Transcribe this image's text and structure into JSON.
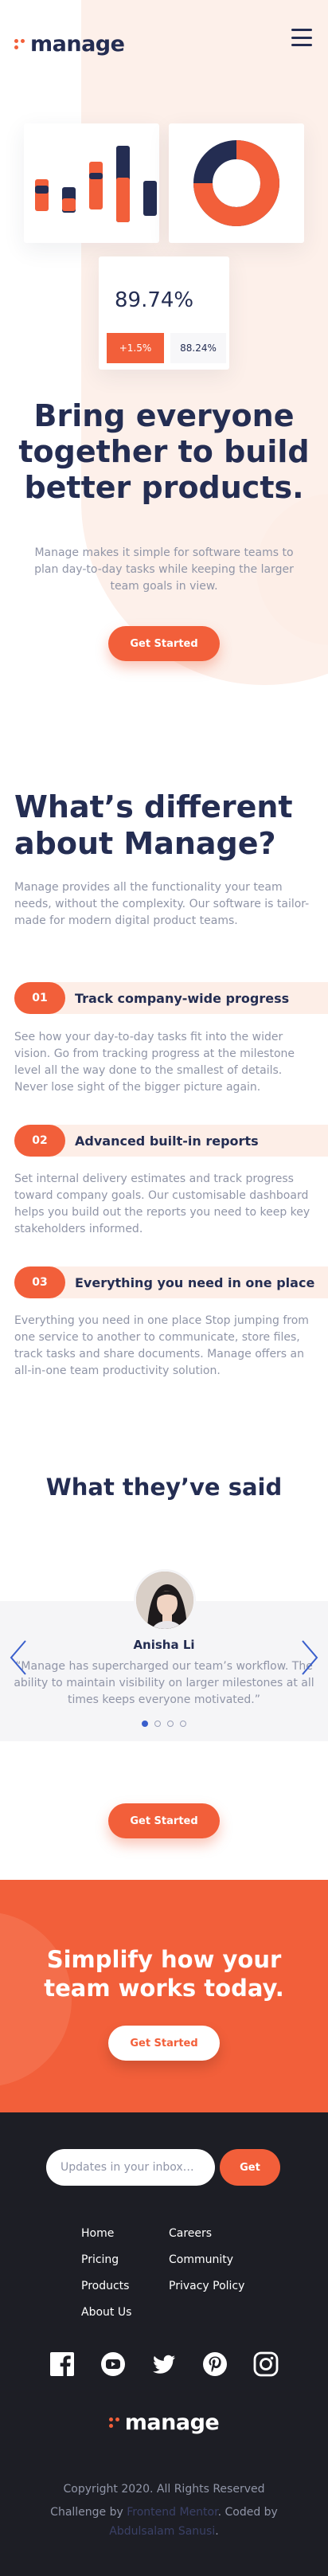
{
  "brand": {
    "name": "manage",
    "accent": "#f25f3a",
    "navy": "#242d52",
    "muted": "#9095a7",
    "pale": "#fdeee7"
  },
  "header": {
    "menu_icon": "hamburger-icon"
  },
  "hero": {
    "stat_value": "89.74%",
    "stat_badge": "+1.5%",
    "stat_secondary": "88.24%",
    "donut_fill": 0.75,
    "title": "Bring everyone together to build better products.",
    "text": "Manage makes it simple for software teams to plan day-to-day tasks while keeping the larger team goals in view.",
    "cta": "Get Started"
  },
  "different": {
    "title": "What’s different about Manage?",
    "text": "Manage provides all the functionality your team needs, without the complexity. Our software is tailor-made for modern digital product teams.",
    "features": [
      {
        "num": "01",
        "title": "Track company-wide progress",
        "desc": "See how your day-to-day tasks fit into the wider vision. Go from tracking progress at the milestone level all the way done to the smallest of details. Never lose sight of the bigger picture again."
      },
      {
        "num": "02",
        "title": "Advanced built-in reports",
        "desc": "Set internal delivery estimates and track progress toward company goals. Our customisable dashboard helps you build out the reports you need to keep key stakeholders informed."
      },
      {
        "num": "03",
        "title": "Everything you need in one place",
        "desc": "Everything you need in one place Stop jumping from one service to another to communicate, store files, track tasks and share documents. Manage offers an all-in-one team productivity solution."
      }
    ]
  },
  "testimonials": {
    "title": "What they’ve said",
    "name": "Anisha Li",
    "quote": "“Manage has supercharged our team’s workflow. The ability to maintain visibility on larger milestones at all times keeps everyone motivated.”",
    "prev_icon": "chevron-left-icon",
    "next_icon": "chevron-right-icon",
    "slide_count": 4,
    "active_slide": 1,
    "cta": "Get Started"
  },
  "cta_band": {
    "title": "Simplify how your team works today.",
    "button": "Get Started"
  },
  "footer": {
    "newsletter_placeholder": "Updates in your inbox…",
    "newsletter_button": "Get",
    "links_left": [
      "Home",
      "Pricing",
      "Products",
      "About Us"
    ],
    "links_right": [
      "Careers",
      "Community",
      "Privacy Policy"
    ],
    "socials": [
      "facebook-icon",
      "youtube-icon",
      "twitter-icon",
      "pinterest-icon",
      "instagram-icon"
    ],
    "copyright": "Copyright 2020. All Rights Reserved",
    "attribution_prefix": "Challenge by",
    "attribution_link1": "Frontend Mentor",
    "attribution_middle": ". Coded by",
    "attribution_link2": "Abdulsalam Sanusi"
  }
}
